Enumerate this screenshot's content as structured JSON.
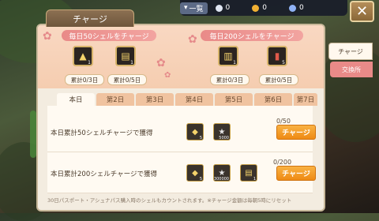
{
  "topbar": {
    "dropdown_label": "一覧",
    "currency1": "0",
    "currency2": "0",
    "currency3": "0"
  },
  "window": {
    "title": "チャージ"
  },
  "banner": {
    "left_heading": "毎日50シェルをチャージ",
    "right_heading": "毎日200シェルをチャージ",
    "rewards": [
      {
        "count": "1",
        "cumulative": "累計0/3日"
      },
      {
        "count": "1",
        "cumulative": "累計0/5日"
      },
      {
        "count": "1",
        "cumulative": "累計0/3日"
      },
      {
        "count": "5",
        "cumulative": "累計0/5日"
      }
    ]
  },
  "tabs": [
    "本日",
    "第2日",
    "第3日",
    "第4日",
    "第5日",
    "第6日",
    "第7日"
  ],
  "missions": [
    {
      "text": "本日累計50シェルチャージで獲得",
      "progress": "0/50",
      "button": "チャージ",
      "rewards": [
        "5",
        "5000"
      ]
    },
    {
      "text": "本日累計200シェルチャージで獲得",
      "progress": "0/200",
      "button": "チャージ",
      "rewards": [
        "5",
        "300000",
        "1"
      ]
    }
  ],
  "footer": "30日パスポート・アシュナパス購入時のシェルもカウントされます。※チャージ金額は毎朝5時にリセット",
  "side_tabs": {
    "charge": "チャージ",
    "exchange": "交換所"
  },
  "colors": {
    "accent_orange": "#ee8a14",
    "banner_pink": "#e98a88",
    "panel_bg": "#f3ece0"
  }
}
